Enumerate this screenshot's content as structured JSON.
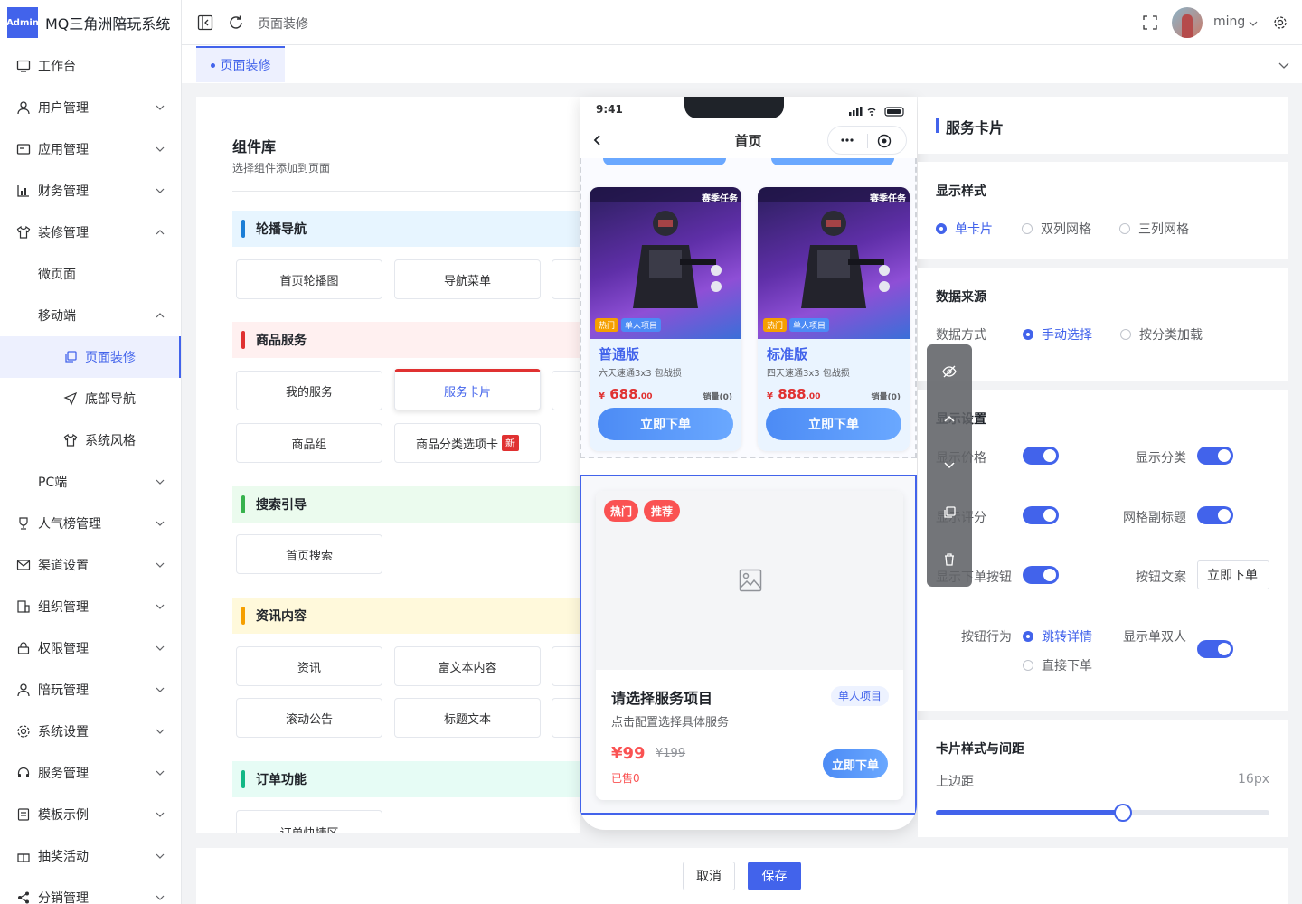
{
  "app": {
    "logo_badge": "Admin",
    "title": "MQ三角洲陪玩系统"
  },
  "header": {
    "breadcrumb": "页面装修",
    "user_name": "ming"
  },
  "tabs": [
    {
      "label": "页面装修"
    }
  ],
  "sidebar": {
    "items": [
      {
        "label": "工作台"
      },
      {
        "label": "用户管理"
      },
      {
        "label": "应用管理"
      },
      {
        "label": "财务管理"
      },
      {
        "label": "装修管理"
      },
      {
        "label": "微页面"
      },
      {
        "label": "移动端"
      },
      {
        "label": "页面装修"
      },
      {
        "label": "底部导航"
      },
      {
        "label": "系统风格"
      },
      {
        "label": "PC端"
      },
      {
        "label": "人气榜管理"
      },
      {
        "label": "渠道设置"
      },
      {
        "label": "组织管理"
      },
      {
        "label": "权限管理"
      },
      {
        "label": "陪玩管理"
      },
      {
        "label": "系统设置"
      },
      {
        "label": "服务管理"
      },
      {
        "label": "模板示例"
      },
      {
        "label": "抽奖活动"
      },
      {
        "label": "分销管理"
      }
    ]
  },
  "library": {
    "title": "组件库",
    "subtitle": "选择组件添加到页面",
    "groups": [
      {
        "title": "轮播导航",
        "color": "#1c7ed6",
        "bg": "#e7f5ff",
        "items": [
          "首页轮播图",
          "导航菜单"
        ]
      },
      {
        "title": "商品服务",
        "color": "#e03131",
        "bg": "#fff0f0",
        "items": [
          "我的服务",
          "服务卡片",
          "商品组",
          "商品分类选项卡"
        ],
        "new_badge": "新"
      },
      {
        "title": "搜索引导",
        "color": "#37b24d",
        "bg": "#ebfbee",
        "items": [
          "首页搜索"
        ]
      },
      {
        "title": "资讯内容",
        "color": "#f59f00",
        "bg": "#fff9db",
        "items": [
          "资讯",
          "富文本内容",
          "滚动公告",
          "标题文本"
        ]
      },
      {
        "title": "订单功能",
        "color": "#12b886",
        "bg": "#e6fcf5",
        "items": [
          "订单快捷区"
        ]
      }
    ]
  },
  "phone": {
    "time": "9:41",
    "nav_title": "首页",
    "cards": [
      {
        "name": "普通版",
        "desc": "六天速通3x3 包战损",
        "price_symbol": "¥",
        "price": "688",
        "price_dec": ".00",
        "sold": "销量(0)",
        "button": "立即下单",
        "tag_hot": "热门",
        "tag_type": "单人项目",
        "banner_text": "赛季任务"
      },
      {
        "name": "标准版",
        "desc": "四天速通3x3 包战损",
        "price_symbol": "¥",
        "price": "888",
        "price_dec": ".00",
        "sold": "销量(0)",
        "button": "立即下单",
        "tag_hot": "热门",
        "tag_type": "单人项目",
        "banner_text": "赛季任务"
      }
    ],
    "selected_card": {
      "badge_hot": "热门",
      "badge_rec": "推荐",
      "title": "请选择服务项目",
      "type_tag": "单人项目",
      "desc": "点击配置选择具体服务",
      "price": "¥99",
      "old_price": "¥199",
      "sold": "已售0",
      "button": "立即下单"
    }
  },
  "panel": {
    "title": "服务卡片",
    "style": {
      "title": "显示样式",
      "options": [
        "单卡片",
        "双列网格",
        "三列网格"
      ],
      "selected": 0
    },
    "source": {
      "title": "数据来源",
      "label": "数据方式",
      "options": [
        "手动选择",
        "按分类加载"
      ],
      "selected": 0
    },
    "display": {
      "title": "显示设置",
      "show_price": "显示价格",
      "show_category": "显示分类",
      "show_rating": "显示评分",
      "grid_subtitle": "网格副标题",
      "show_button": "显示下单按钮",
      "button_text_label": "按钮文案",
      "button_text_value": "立即下单",
      "button_action_label": "按钮行为",
      "button_actions": [
        "跳转详情",
        "直接下单"
      ],
      "show_single_double": "显示单双人"
    },
    "card_style": {
      "title": "卡片样式与间距",
      "top_margin_label": "上边距",
      "top_margin_value": "16px",
      "slider_fraction": 0.56
    }
  },
  "footer": {
    "cancel": "取消",
    "save": "保存"
  },
  "colors": {
    "primary": "#4263eb",
    "danger": "#e03131"
  }
}
